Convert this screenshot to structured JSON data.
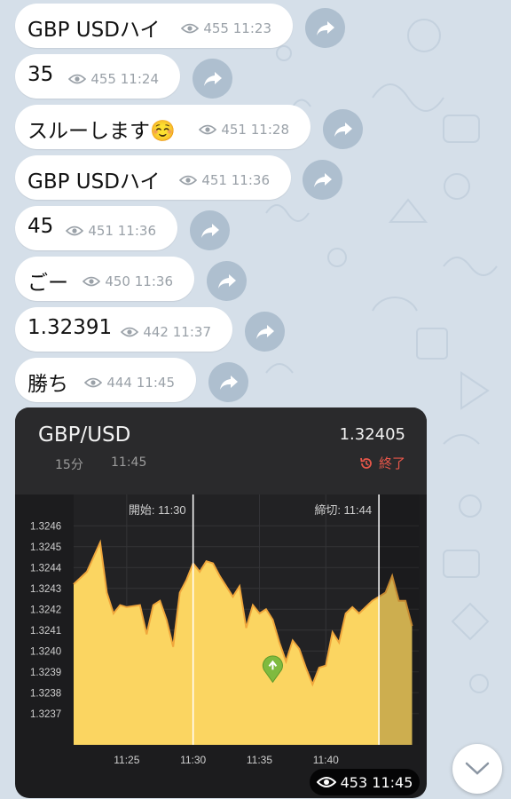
{
  "messages": [
    {
      "text": "GBP USDハイ",
      "views": "455",
      "time": "11:23"
    },
    {
      "text": "35",
      "views": "455",
      "time": "11:24"
    },
    {
      "text": "スルーします☺️",
      "views": "451",
      "time": "11:28"
    },
    {
      "text": "GBP USDハイ",
      "views": "451",
      "time": "11:36"
    },
    {
      "text": "45",
      "views": "451",
      "time": "11:36"
    },
    {
      "text": "ごー",
      "views": "450",
      "time": "11:36"
    },
    {
      "text": "1.32391",
      "views": "442",
      "time": "11:37"
    },
    {
      "text": "勝ち",
      "views": "444",
      "time": "11:45"
    }
  ],
  "chart_card": {
    "pair": "GBP/USD",
    "price": "1.32405",
    "interval": "15分",
    "time": "11:45",
    "status": "終了",
    "status_color": "#e8574a",
    "views": "453",
    "post_time": "11:45"
  },
  "chart_data": {
    "type": "area",
    "title": "",
    "xlabel": "",
    "ylabel": "",
    "xlim": [
      "11:21",
      "11:47"
    ],
    "ylim": [
      1.32355,
      1.32475
    ],
    "y_ticks": [
      1.3237,
      1.3238,
      1.3239,
      1.324,
      1.3241,
      1.3242,
      1.3243,
      1.3244,
      1.3245,
      1.3246
    ],
    "y_tick_labels": [
      "1.3237",
      "1.3238",
      "1.3239",
      "1.3240",
      "1.3241",
      "1.3242",
      "1.3243",
      "1.3244",
      "1.3245",
      "1.3246"
    ],
    "x_ticks": [
      "11:25",
      "11:30",
      "11:35",
      "11:40"
    ],
    "grid": true,
    "fill_color": "#fbd561",
    "line_color": "#f0a73c",
    "series": [
      {
        "x": [
          "11:21",
          "11:22",
          "11:23",
          "11:23:30",
          "11:24",
          "11:24:30",
          "11:25",
          "11:26",
          "11:26:30",
          "11:27",
          "11:27:30",
          "11:28",
          "11:28:30",
          "11:29",
          "11:29:30",
          "11:30",
          "11:30:30",
          "11:31",
          "11:31:30",
          "11:32",
          "11:33",
          "11:33:30",
          "11:34",
          "11:34:30",
          "11:35",
          "11:35:30",
          "11:36",
          "11:36:30",
          "11:37",
          "11:37:30",
          "11:38",
          "11:38:30",
          "11:39",
          "11:39:30",
          "11:40",
          "11:40:30",
          "11:41",
          "11:41:30",
          "11:42",
          "11:42:30",
          "11:43",
          "11:43:30",
          "11:44",
          "11:44:30",
          "11:45",
          "11:45:30",
          "11:46",
          "11:46:30"
        ],
        "y": [
          1.32432,
          1.32438,
          1.32452,
          1.32428,
          1.32418,
          1.32422,
          1.32421,
          1.32422,
          1.32408,
          1.32422,
          1.32424,
          1.32415,
          1.32402,
          1.32428,
          1.32434,
          1.32442,
          1.32438,
          1.32443,
          1.32442,
          1.32436,
          1.32426,
          1.32431,
          1.32411,
          1.32422,
          1.32418,
          1.3242,
          1.32415,
          1.32404,
          1.32395,
          1.32405,
          1.32401,
          1.32392,
          1.32384,
          1.32392,
          1.32393,
          1.32409,
          1.32404,
          1.32418,
          1.32421,
          1.32418,
          1.32421,
          1.32424,
          1.32426,
          1.32428,
          1.32436,
          1.32424,
          1.32424,
          1.32412
        ]
      }
    ],
    "markers": {
      "start": {
        "x": "11:30",
        "label": "開始: 11:30"
      },
      "end": {
        "x": "11:44",
        "label": "締切: 11:44"
      },
      "entry": {
        "x": "11:36",
        "y": 1.32391
      }
    }
  }
}
